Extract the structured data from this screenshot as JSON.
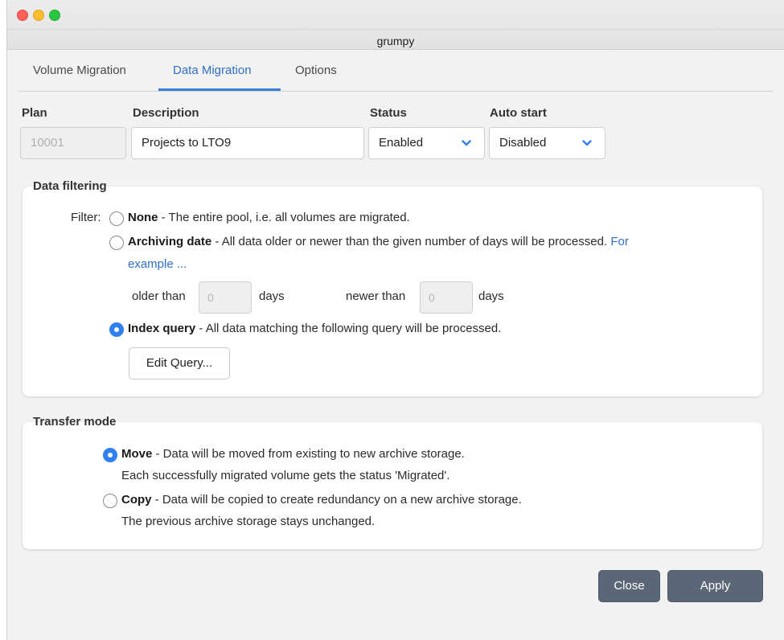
{
  "window": {
    "title": "grumpy"
  },
  "tabs": [
    {
      "label": "Volume Migration"
    },
    {
      "label": "Data Migration"
    },
    {
      "label": "Options"
    }
  ],
  "form": {
    "plan": {
      "label": "Plan",
      "value": "10001"
    },
    "description": {
      "label": "Description",
      "value": "Projects to LTO9"
    },
    "status": {
      "label": "Status",
      "value": "Enabled"
    },
    "auto_start": {
      "label": "Auto start",
      "value": "Disabled"
    }
  },
  "data_filtering": {
    "title": "Data filtering",
    "filter_label": "Filter:",
    "none": {
      "label": "None",
      "desc": " - The entire pool, i.e. all volumes are migrated."
    },
    "archiving_date": {
      "label": "Archiving date",
      "desc": " - All data older or newer than the given number of days will be processed.",
      "link_part1": "For",
      "link_part2": "example ..."
    },
    "older_than_label": "older than",
    "older_than_value": "0",
    "newer_than_label": "newer than",
    "newer_than_value": "0",
    "days_label": "days",
    "index_query": {
      "label": "Index query",
      "desc": " - All data matching the following query will be processed."
    },
    "edit_query_button": "Edit Query...",
    "selected": "index_query"
  },
  "transfer_mode": {
    "title": "Transfer mode",
    "move": {
      "label": "Move",
      "desc": " - Data will be moved from existing to new archive storage.",
      "desc2": "Each successfully migrated volume gets the status 'Migrated'."
    },
    "copy": {
      "label": "Copy",
      "desc": " - Data will be copied to create redundancy on a new archive storage.",
      "desc2": "The previous archive storage stays unchanged."
    },
    "selected": "move"
  },
  "buttons": {
    "close": "Close",
    "apply": "Apply"
  },
  "colors": {
    "accent": "#2f80f0",
    "tab_active": "#2f6fcb",
    "button_dark": "#5b6776"
  }
}
